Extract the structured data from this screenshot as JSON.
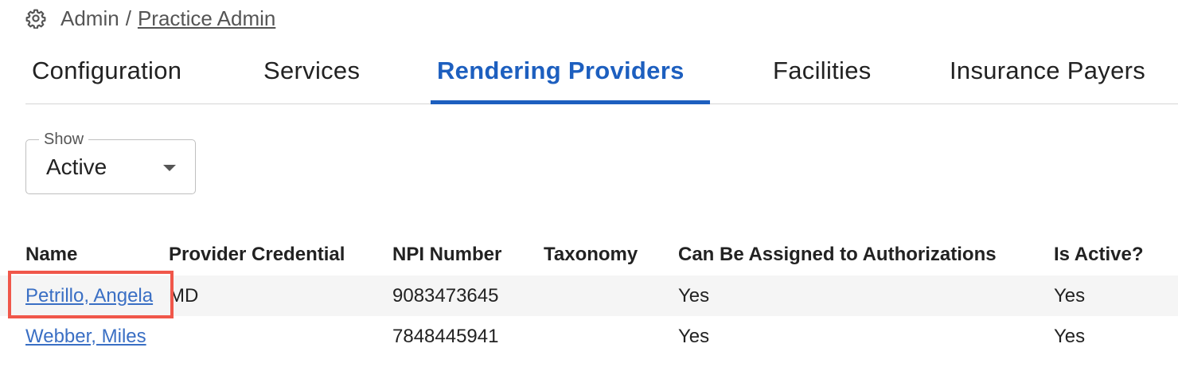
{
  "breadcrumb": {
    "icon": "gear-icon",
    "root": "Admin",
    "separator": "/",
    "current": "Practice Admin"
  },
  "tabs": [
    {
      "label": "Configuration",
      "active": false
    },
    {
      "label": "Services",
      "active": false
    },
    {
      "label": "Rendering Providers",
      "active": true
    },
    {
      "label": "Facilities",
      "active": false
    },
    {
      "label": "Insurance Payers",
      "active": false
    }
  ],
  "filter": {
    "label": "Show",
    "value": "Active",
    "icon": "dropdown-arrow-icon"
  },
  "table": {
    "columns": [
      "Name",
      "Provider Credential",
      "NPI Number",
      "Taxonomy",
      "Can Be Assigned to Authorizations",
      "Is Active?"
    ],
    "rows": [
      {
        "name": "Petrillo, Angela",
        "credential": "MD",
        "npi": "9083473645",
        "taxonomy": "",
        "assignable": "Yes",
        "active": "Yes"
      },
      {
        "name": "Webber, Miles",
        "credential": "",
        "npi": "7848445941",
        "taxonomy": "",
        "assignable": "Yes",
        "active": "Yes"
      }
    ]
  },
  "colors": {
    "accent": "#1d5fbf",
    "link": "#3a6fc4",
    "highlight": "#f0574a",
    "row_stripe": "#f5f5f5"
  }
}
